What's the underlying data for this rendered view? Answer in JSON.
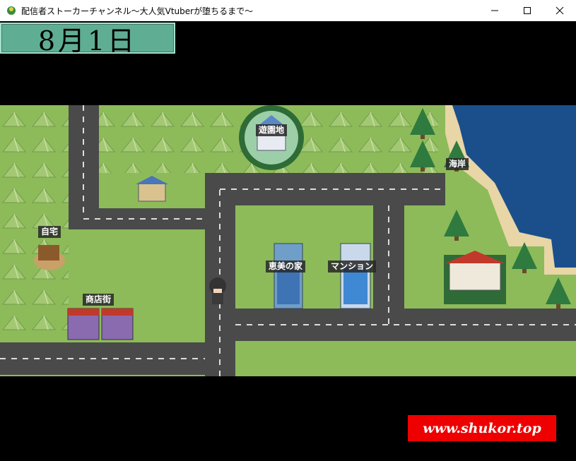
{
  "window": {
    "title": "配信者ストーカーチャンネル～大人気Vtuberが堕ちるまで～",
    "icons": [
      "app-icon",
      "minimize-icon",
      "maximize-icon",
      "close-icon"
    ]
  },
  "hud": {
    "date": "8月1日"
  },
  "map": {
    "locations": {
      "amusement_park": "遊園地",
      "coast": "海岸",
      "home": "自宅",
      "emi_house": "恵美の家",
      "mansion": "マンション",
      "shopping_street": "商店街"
    },
    "colors": {
      "grass": "#8dbb5a",
      "road": "#4a4a4a",
      "sea": "#1b4f8c",
      "sand": "#e8d6a6"
    }
  },
  "watermark": {
    "text": "www.shukor.top"
  }
}
